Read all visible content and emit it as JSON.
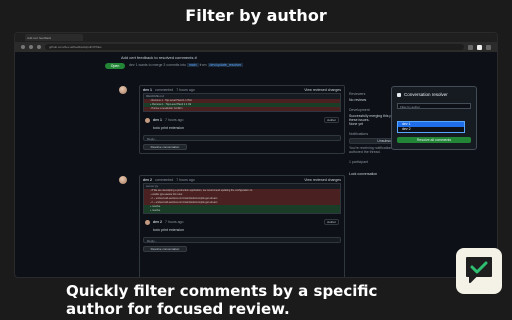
{
  "headline": "Filter by author",
  "caption": "Quickly filter comments by a specific author for focused review.",
  "browser": {
    "tab_title": "Add  cert feedback",
    "url": "github.com/dev-ai/feedback/pull/47/files"
  },
  "pr": {
    "title": "Add  cert feedback to resolved comments #",
    "status": "Open",
    "meta": "dev 1 wants to merge 3 commits into",
    "base_branch": "main",
    "from_label": "from",
    "head_branch": "dev/update_resolver"
  },
  "threads": [
    {
      "author": "dev 1",
      "action": "commented",
      "time": "7 hours ago",
      "view_label": "View reviewed changes",
      "file": "README.md",
      "diff_lines": [
        {
          "type": "del",
          "text": "-  Remove 1 . Top-Level Hand 1.1 Hint"
        },
        {
          "type": "add",
          "text": "+  Remove 1 . Top-Level Hand 1.1 Ok"
        },
        {
          "type": "del",
          "text": "-  Pursue a  resolution  Confirm"
        }
      ],
      "comment_author": "dev 1",
      "comment_time": "7 hours ago",
      "role": "Author",
      "body": "toxic print extension",
      "reply_placeholder": "Reply...",
      "resolve_label": "Resolve conversation"
    },
    {
      "author": "dev 2",
      "action": "commented",
      "time": "7 hours ago",
      "view_label": "View reviewed changes",
      "file": "server.py",
      "diff_lines": [
        {
          "type": "del",
          "text": "-  # We are developing a production application, we recommend updating the configuration to"
        },
        {
          "type": "del",
          "text": "-  enable type-aware lint rules:"
        },
        {
          "type": "del",
          "text": "-  // ~ embed.call-sections.com/main/tools/compile:get-stream"
        },
        {
          "type": "del",
          "text": "-  // ~ embed.call-sections.com/main/tools/compile:get-stream"
        },
        {
          "type": "add",
          "text": "+  resolve"
        },
        {
          "type": "add",
          "text": "+  resolve"
        }
      ],
      "comment_author": "dev 2",
      "comment_time": "7 hours ago",
      "role": "Author",
      "body": "toxic print extension",
      "reply_placeholder": "Reply...",
      "resolve_label": "Resolve conversation"
    }
  ],
  "sidebar": {
    "reviewers_label": "Reviewers",
    "reviewers_value": "No reviews",
    "development_label": "Development",
    "development_value": "Successfully merging this pull request may close these issues.",
    "milestone_value": "None yet",
    "notifications_label": "Notifications",
    "customize_label": "Customize",
    "unsubscribe_label": "Unsubscribe",
    "notify_text": "You're receiving notifications because you authored the thread.",
    "participants_label": "1 participant",
    "lock_label": "Lock conversation"
  },
  "panel": {
    "title": "Conversation resolver",
    "select_placeholder": "Filter by author",
    "options": [
      "dev 1",
      "dev 2"
    ],
    "selected_index": 0,
    "resolve_all_label": "Resolve all comments"
  },
  "colors": {
    "accent": "#1f6feb",
    "success": "#238636",
    "logo_bg": "#f4f1e7",
    "logo_check": "#2fbf71"
  },
  "icons": [
    "message-check-icon",
    "conversation-icon"
  ]
}
